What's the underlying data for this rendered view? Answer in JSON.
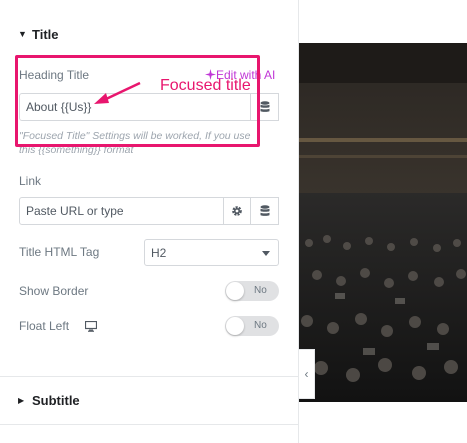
{
  "panel": {
    "title_section": {
      "label": "Title",
      "caret": "▼"
    },
    "heading_title": {
      "label": "Heading Title",
      "ai_link": "Edit with AI",
      "value": "About {{Us}}",
      "help": "\"Focused Title\" Settings will be worked, If you use this {{something}} format"
    },
    "link": {
      "label": "Link",
      "placeholder": "Paste URL or type"
    },
    "html_tag": {
      "label": "Title HTML Tag",
      "selected": "H2"
    },
    "show_border": {
      "label": "Show Border",
      "state": "No"
    },
    "float_left": {
      "label": "Float Left",
      "state": "No"
    },
    "subtitle_section": {
      "label": "Subtitle",
      "caret": "▶"
    }
  },
  "annotation": {
    "text": "Focused title",
    "color": "#e8166e"
  },
  "colors": {
    "accent_ai": "#c036d6",
    "highlight": "#e8166e"
  },
  "icons": [
    "sparkle-icon",
    "database-icon",
    "gear-icon",
    "desktop-icon",
    "chevron-left-icon"
  ]
}
